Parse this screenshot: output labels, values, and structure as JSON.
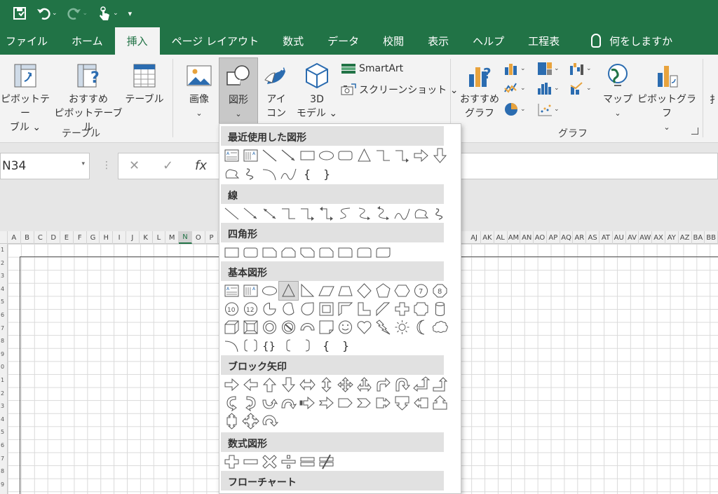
{
  "qat": {
    "save_icon": "save-icon",
    "undo_icon": "undo-icon",
    "redo_icon": "redo-icon",
    "touch_icon": "touch-mode-icon",
    "customize_icon": "customize-qat-icon"
  },
  "tabs": [
    {
      "label": "ファイル"
    },
    {
      "label": "ホーム"
    },
    {
      "label": "挿入",
      "active": true
    },
    {
      "label": "ページ レイアウト"
    },
    {
      "label": "数式"
    },
    {
      "label": "データ"
    },
    {
      "label": "校閲"
    },
    {
      "label": "表示"
    },
    {
      "label": "ヘルプ"
    },
    {
      "label": "工程表"
    }
  ],
  "tell_me": "何をしますか",
  "ribbon": {
    "pivot_table": [
      "ピボットテー",
      "ブル ⌄"
    ],
    "recommended_pivot": [
      "おすすめ",
      "ピボットテーブル"
    ],
    "table": "テーブル",
    "group_table": "テーブル",
    "image": [
      "画像",
      "⌄"
    ],
    "shapes": [
      "図形",
      "⌄"
    ],
    "icons": [
      "アイ",
      "コン"
    ],
    "model3d": [
      "3D",
      "モデル ⌄"
    ],
    "smartart": "SmartArt",
    "screenshot": "スクリーンショット ⌄",
    "recommended_chart": [
      "おすすめ",
      "グラフ"
    ],
    "maps": [
      "マップ",
      "⌄"
    ],
    "pivot_chart": [
      "ピボットグラフ",
      "⌄"
    ],
    "group_chart": "グラフ"
  },
  "formula": {
    "name_box": "N34",
    "cancel": "✕",
    "enter": "✓",
    "fx": "fx"
  },
  "columns": [
    "A",
    "B",
    "C",
    "D",
    "E",
    "F",
    "G",
    "H",
    "I",
    "J",
    "K",
    "L",
    "M",
    "N",
    "O",
    "P"
  ],
  "columns_right": [
    "AJ",
    "AK",
    "AL",
    "AM",
    "AN",
    "AO",
    "AP",
    "AQ",
    "AR",
    "AS",
    "AT",
    "AU",
    "AV",
    "AW",
    "AX",
    "AY",
    "AZ",
    "BA",
    "BB"
  ],
  "rows": [
    "1",
    "2",
    "3",
    "4",
    "5",
    "6",
    "7",
    "8",
    "9",
    "0",
    "1",
    "2",
    "3",
    "4",
    "5",
    "6",
    "7",
    "8",
    "9"
  ],
  "shapes_menu": {
    "categories": [
      "最近使用した図形",
      "線",
      "四角形",
      "基本図形",
      "ブロック矢印",
      "数式図形",
      "フローチャート"
    ]
  },
  "colors": {
    "excel_green": "#217346",
    "ribbon_bg": "#f3f3f3",
    "category_bg": "#e1e1e1"
  }
}
